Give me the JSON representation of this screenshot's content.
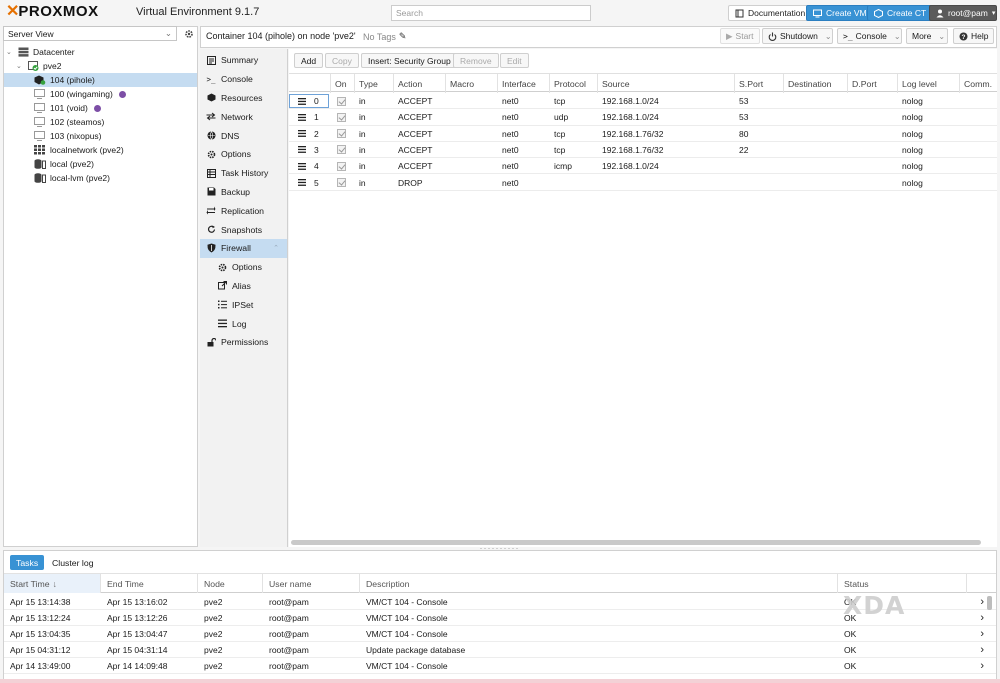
{
  "app": {
    "logo": "PROXMOX",
    "subtitle": "Virtual Environment 9.1.7",
    "search_placeholder": "Search",
    "buttons": {
      "documentation": "Documentation",
      "create_vm": "Create VM",
      "create_ct": "Create CT",
      "user": "root@pam"
    }
  },
  "tree": {
    "view": "Server View",
    "nodes": [
      {
        "label": "Datacenter",
        "icon": "datacenter-icon"
      },
      {
        "label": "pve2",
        "icon": "node-icon"
      },
      {
        "label": "104 (pihole)",
        "icon": "container-running-icon",
        "selected": true
      },
      {
        "label": "100 (wingaming)",
        "icon": "vm-icon",
        "tag": "#7d4fa6"
      },
      {
        "label": "101 (void)",
        "icon": "vm-icon",
        "tag": "#7d4fa6"
      },
      {
        "label": "102 (steamos)",
        "icon": "vm-icon"
      },
      {
        "label": "103 (nixopus)",
        "icon": "vm-icon"
      },
      {
        "label": "localnetwork (pve2)",
        "icon": "network-grid-icon"
      },
      {
        "label": "local (pve2)",
        "icon": "storage-icon"
      },
      {
        "label": "local-lvm (pve2)",
        "icon": "storage-icon"
      }
    ]
  },
  "header": {
    "title": "Container 104 (pihole) on node 'pve2'",
    "tags": "No Tags",
    "start": "Start",
    "shutdown": "Shutdown",
    "console": "Console",
    "more": "More",
    "help": "Help"
  },
  "menu": {
    "items": [
      {
        "label": "Summary",
        "icon": "summary-icon"
      },
      {
        "label": "Console",
        "icon": "console-icon"
      },
      {
        "label": "Resources",
        "icon": "resources-icon"
      },
      {
        "label": "Network",
        "icon": "network-icon"
      },
      {
        "label": "DNS",
        "icon": "dns-icon"
      },
      {
        "label": "Options",
        "icon": "gear-icon"
      },
      {
        "label": "Task History",
        "icon": "task-history-icon"
      },
      {
        "label": "Backup",
        "icon": "backup-icon"
      },
      {
        "label": "Replication",
        "icon": "replication-icon"
      },
      {
        "label": "Snapshots",
        "icon": "snapshots-icon"
      },
      {
        "label": "Firewall",
        "icon": "shield-icon",
        "selected": true
      },
      {
        "label": "Options",
        "icon": "gear-icon",
        "sub": true
      },
      {
        "label": "Alias",
        "icon": "alias-icon",
        "sub": true
      },
      {
        "label": "IPSet",
        "icon": "ipset-icon",
        "sub": true
      },
      {
        "label": "Log",
        "icon": "log-icon",
        "sub": true
      },
      {
        "label": "Permissions",
        "icon": "permissions-icon"
      }
    ]
  },
  "firewall": {
    "toolbar": {
      "add": "Add",
      "copy": "Copy",
      "insert": "Insert: Security Group",
      "remove": "Remove",
      "edit": "Edit"
    },
    "columns": [
      "",
      "On",
      "Type",
      "Action",
      "Macro",
      "Interface",
      "Protocol",
      "Source",
      "S.Port",
      "Destination",
      "D.Port",
      "Log level",
      "Comm."
    ],
    "rows": [
      {
        "pos": "0",
        "type": "in",
        "action": "ACCEPT",
        "macro": "",
        "iface": "net0",
        "proto": "tcp",
        "source": "192.168.1.0/24",
        "sport": "53",
        "dest": "",
        "dport": "",
        "log": "nolog"
      },
      {
        "pos": "1",
        "type": "in",
        "action": "ACCEPT",
        "macro": "",
        "iface": "net0",
        "proto": "udp",
        "source": "192.168.1.0/24",
        "sport": "53",
        "dest": "",
        "dport": "",
        "log": "nolog"
      },
      {
        "pos": "2",
        "type": "in",
        "action": "ACCEPT",
        "macro": "",
        "iface": "net0",
        "proto": "tcp",
        "source": "192.168.1.76/32",
        "sport": "80",
        "dest": "",
        "dport": "",
        "log": "nolog"
      },
      {
        "pos": "3",
        "type": "in",
        "action": "ACCEPT",
        "macro": "",
        "iface": "net0",
        "proto": "tcp",
        "source": "192.168.1.76/32",
        "sport": "22",
        "dest": "",
        "dport": "",
        "log": "nolog"
      },
      {
        "pos": "4",
        "type": "in",
        "action": "ACCEPT",
        "macro": "",
        "iface": "net0",
        "proto": "icmp",
        "source": "192.168.1.0/24",
        "sport": "",
        "dest": "",
        "dport": "",
        "log": "nolog"
      },
      {
        "pos": "5",
        "type": "in",
        "action": "DROP",
        "macro": "",
        "iface": "net0",
        "proto": "",
        "source": "",
        "sport": "",
        "dest": "",
        "dport": "",
        "log": "nolog"
      }
    ]
  },
  "tasks": {
    "tabs": [
      "Tasks",
      "Cluster log"
    ],
    "columns": [
      "Start Time",
      "End Time",
      "Node",
      "User name",
      "Description",
      "Status"
    ],
    "rows": [
      {
        "start": "Apr 15 13:14:38",
        "end": "Apr 15 13:16:02",
        "node": "pve2",
        "user": "root@pam",
        "desc": "VM/CT 104 - Console",
        "status": "OK"
      },
      {
        "start": "Apr 15 13:12:24",
        "end": "Apr 15 13:12:26",
        "node": "pve2",
        "user": "root@pam",
        "desc": "VM/CT 104 - Console",
        "status": "OK"
      },
      {
        "start": "Apr 15 13:04:35",
        "end": "Apr 15 13:04:47",
        "node": "pve2",
        "user": "root@pam",
        "desc": "VM/CT 104 - Console",
        "status": "OK"
      },
      {
        "start": "Apr 15 04:31:12",
        "end": "Apr 15 04:31:14",
        "node": "pve2",
        "user": "root@pam",
        "desc": "Update package database",
        "status": "OK"
      },
      {
        "start": "Apr 14 13:49:00",
        "end": "Apr 14 14:09:48",
        "node": "pve2",
        "user": "root@pam",
        "desc": "VM/CT 104 - Console",
        "status": "OK"
      }
    ]
  },
  "watermark": "XDA",
  "colors": {
    "accent": "#3892d4",
    "logo": "#e57000",
    "selected": "#c5dcf1",
    "tag": "#7d4fa6"
  }
}
